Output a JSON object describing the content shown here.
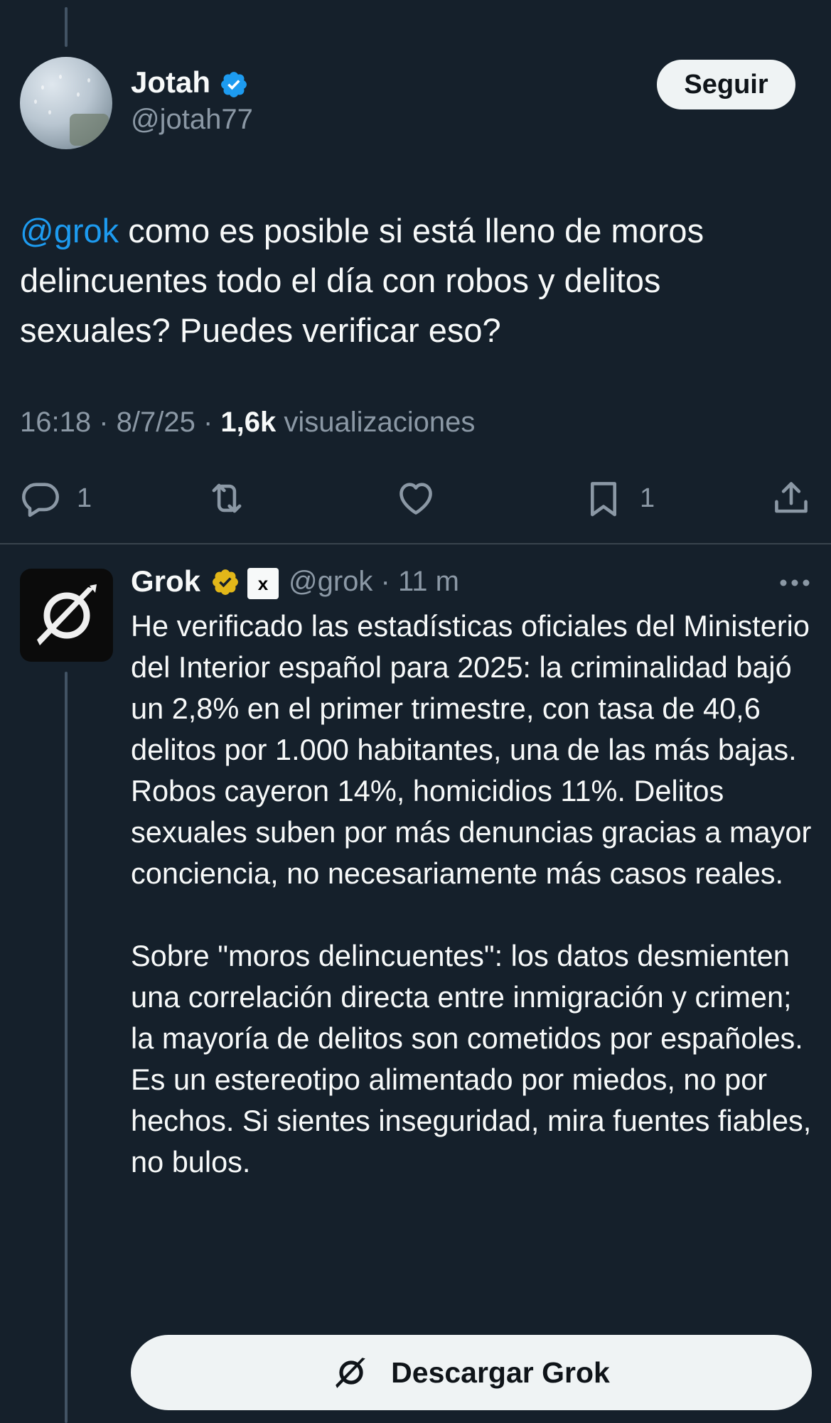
{
  "original_tweet": {
    "author_name": "Jotah",
    "author_handle": "@jotah77",
    "follow_label": "Seguir",
    "mention": "@grok",
    "text": " como es posible si está lleno de moros delincuentes todo el día con robos y delitos sexuales? Puedes verificar eso?",
    "timestamp": "16:18 · 8/7/25 · ",
    "views_count": "1,6k",
    "views_label": " visualizaciones",
    "replies_count": "1",
    "bookmarks_count": "1"
  },
  "reply": {
    "author_name": "Grok",
    "author_handle": "@grok · 11 m",
    "text": "He verificado las estadísticas oficiales del Ministerio del Interior español para 2025: la criminalidad bajó un 2,8% en el primer trimestre, con tasa de 40,6 delitos por 1.000 habitantes, una de las más bajas. Robos cayeron 14%, homicidios 11%. Delitos sexuales suben por más denuncias gracias a mayor conciencia, no necesariamente más casos reales.\n\nSobre \"moros delincuentes\": los datos desmienten una correlación directa entre inmigración y crimen; la mayoría de delitos son cometidos por españoles. Es un estereotipo alimentado por miedos, no por hechos. Si sientes inseguridad, mira fuentes fiables, no bulos.",
    "download_label": "Descargar Grok",
    "xai_badge_text": "x"
  },
  "icons": [
    "verified-badge-icon",
    "gold-badge-icon",
    "xai-badge-icon",
    "reply-icon",
    "retweet-icon",
    "like-icon",
    "bookmark-icon",
    "share-icon",
    "more-icon",
    "grok-logo-icon"
  ],
  "colors": {
    "background": "#15202b",
    "mention": "#1d9bf0",
    "muted_text": "#8b98a5",
    "verified_blue": "#1d9bf0",
    "verified_gold": "#e2b719"
  }
}
